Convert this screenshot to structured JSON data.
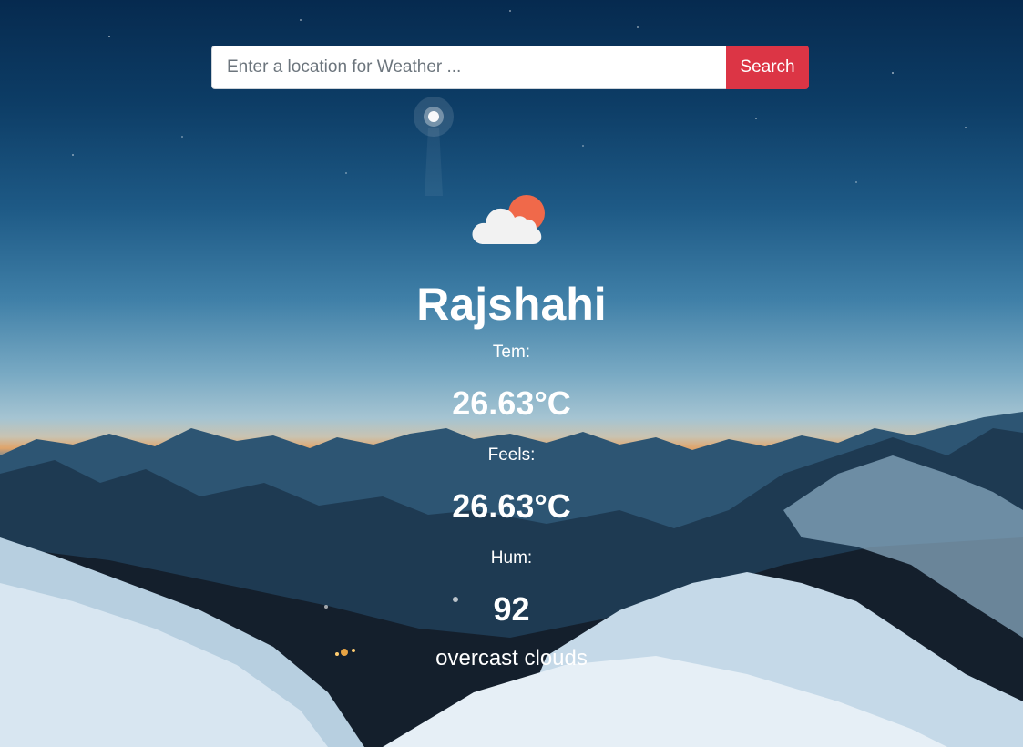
{
  "search": {
    "placeholder": "Enter a location for Weather ...",
    "value": "",
    "button_label": "Search"
  },
  "weather": {
    "icon": "cloud-sun-icon",
    "city": "Rajshahi",
    "temp_label": "Tem:",
    "temp_value": "26.63°C",
    "feels_label": "Feels:",
    "feels_value": "26.63°C",
    "humidity_label": "Hum:",
    "humidity_value": "92",
    "description": "overcast clouds"
  },
  "colors": {
    "search_button": "#dc3545",
    "sun": "#f0694a",
    "cloud": "#f2f2f2",
    "text": "#ffffff"
  }
}
